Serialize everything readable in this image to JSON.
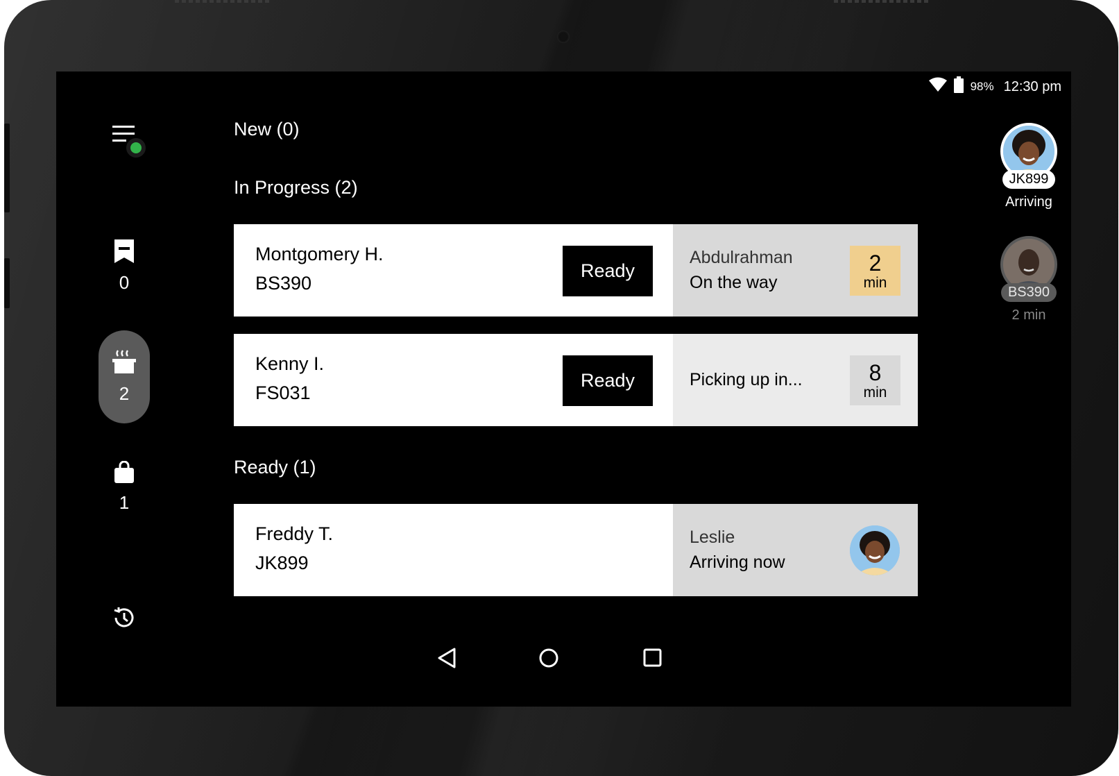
{
  "status_bar": {
    "battery_percent": "98%",
    "time": "12:30 pm",
    "icons": [
      "wifi-icon",
      "battery-icon"
    ]
  },
  "nav": {
    "menu_icon": "menu-icon",
    "online": true,
    "items": [
      {
        "icon": "receipt-icon",
        "count": "0",
        "active": false
      },
      {
        "icon": "cooking-pot-icon",
        "count": "2",
        "active": true
      },
      {
        "icon": "bag-icon",
        "count": "1",
        "active": false
      },
      {
        "icon": "history-icon"
      }
    ]
  },
  "sections": {
    "new": {
      "title": "New (0)"
    },
    "in_progress": {
      "title": "In Progress (2)",
      "orders": [
        {
          "customer": "Montgomery H.",
          "code": "BS390",
          "button": "Ready",
          "driver": "Abdulrahman",
          "driver_status": "On the way",
          "eta_value": "2",
          "eta_unit": "min",
          "eta_color": "#f0cf8e",
          "panel_color": "#d9d9d9"
        },
        {
          "customer": "Kenny I.",
          "code": "FS031",
          "button": "Ready",
          "driver_status": "Picking up in...",
          "eta_value": "8",
          "eta_unit": "min",
          "eta_color": "#d9d9d9",
          "panel_color": "#ebebeb"
        }
      ]
    },
    "ready": {
      "title": "Ready (1)",
      "orders": [
        {
          "customer": "Freddy T.",
          "code": "JK899",
          "driver": "Leslie",
          "driver_status": "Arriving now",
          "panel_color": "#d9d9d9"
        }
      ]
    }
  },
  "arrivals": [
    {
      "code": "JK899",
      "status": "Arriving",
      "active": true
    },
    {
      "code": "BS390",
      "status": "2 min",
      "active": false
    }
  ],
  "system_nav": [
    "back-icon",
    "home-icon",
    "recents-icon"
  ]
}
